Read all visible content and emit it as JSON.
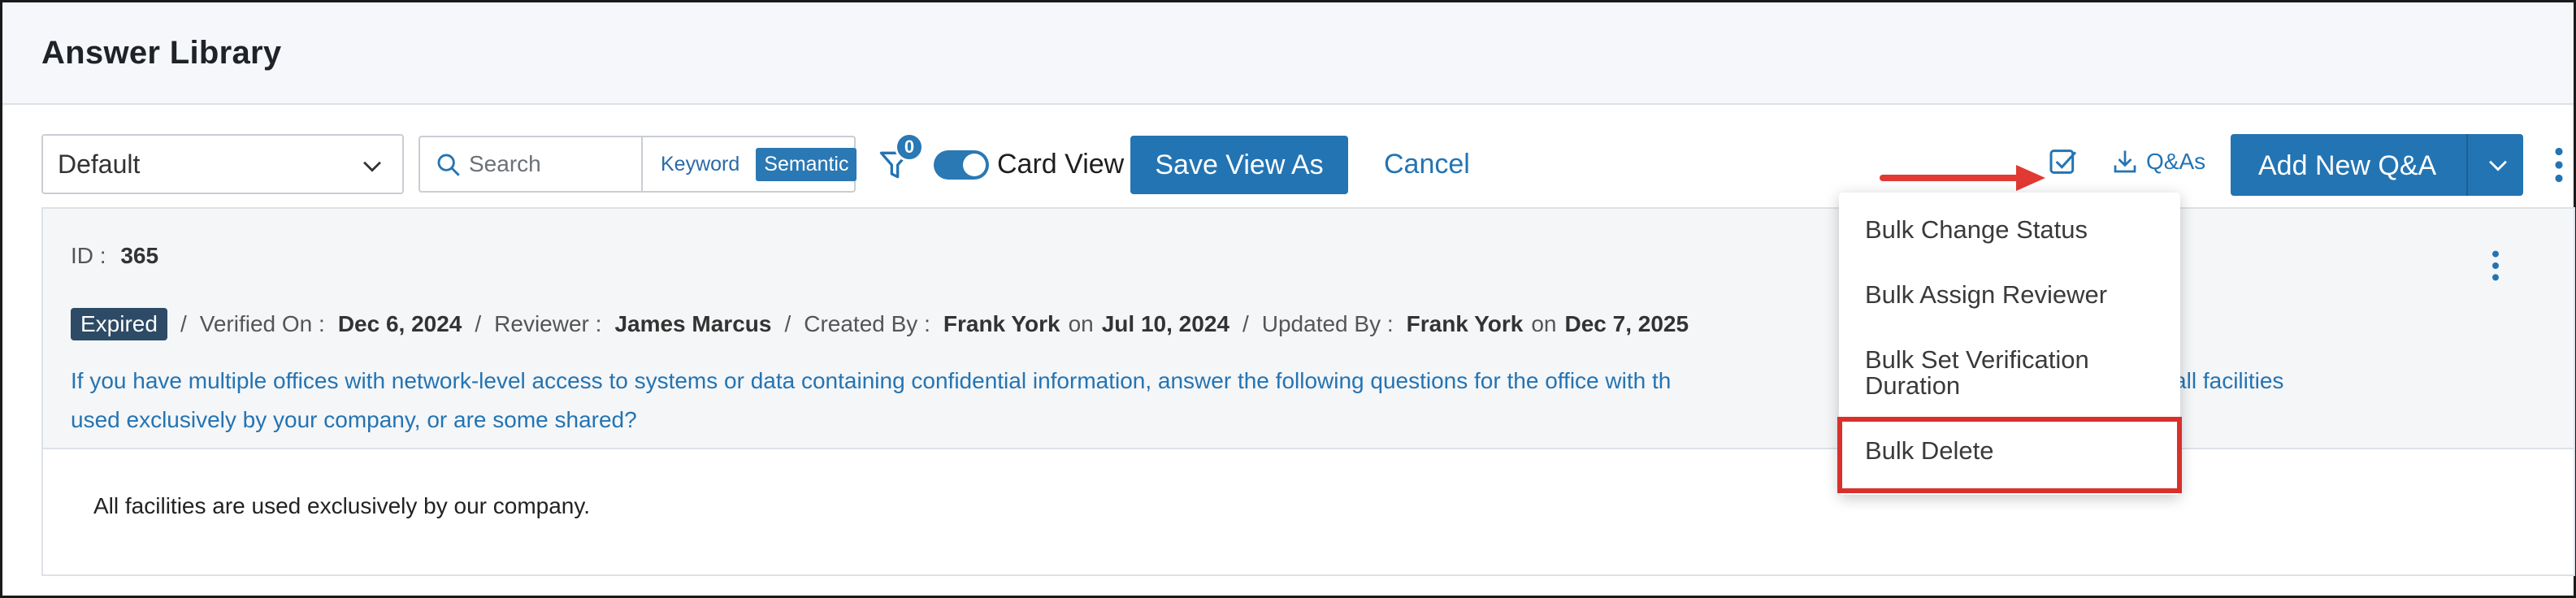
{
  "page": {
    "title": "Answer Library"
  },
  "toolbar": {
    "view_select": {
      "value": "Default",
      "icon": "chevron-down-icon"
    },
    "search": {
      "placeholder": "Search",
      "icon": "search-icon",
      "modes": [
        "Keyword",
        "Semantic"
      ],
      "active_mode": "Semantic"
    },
    "filter": {
      "icon": "filter-icon",
      "badge_count": "0"
    },
    "card_view": {
      "label": "Card View",
      "enabled": true
    },
    "save_view_label": "Save View As",
    "cancel_label": "Cancel",
    "bulk_icon": "checkbox-square-icon",
    "export_label": "Q&As",
    "export_icon": "download-icon",
    "add_label": "Add New Q&A",
    "more_icon": "kebab-icon"
  },
  "card": {
    "id_label": "ID :",
    "id_value": "365",
    "status": "Expired",
    "verified_label": "Verified On :",
    "verified_value": "Dec 6, 2024",
    "reviewer_label": "Reviewer :",
    "reviewer_value": "James Marcus",
    "created_label": "Created By :",
    "created_by": "Frank York",
    "created_on_label": "on",
    "created_date": "Jul 10, 2024",
    "updated_label": "Updated By :",
    "updated_by": "Frank York",
    "updated_on_label": "on",
    "updated_date": "Dec 7, 2025",
    "question_part1": "If you have multiple offices with network-level access to systems or data containing confidential information, answer the following questions for the office with th",
    "question_part2": "weakest link)- Are all facilities",
    "question_line2": "used exclusively by your company, or are some shared?",
    "answer": "All facilities are used exclusively by our company."
  },
  "bulk_menu": {
    "items": [
      "Bulk Change Status",
      "Bulk Assign Reviewer",
      "Bulk Set Verification Duration",
      "Bulk Delete"
    ],
    "highlighted": "Bulk Delete"
  },
  "colors": {
    "primary": "#2374b3",
    "badge": "#2d4a66",
    "highlight": "#d9302c"
  }
}
